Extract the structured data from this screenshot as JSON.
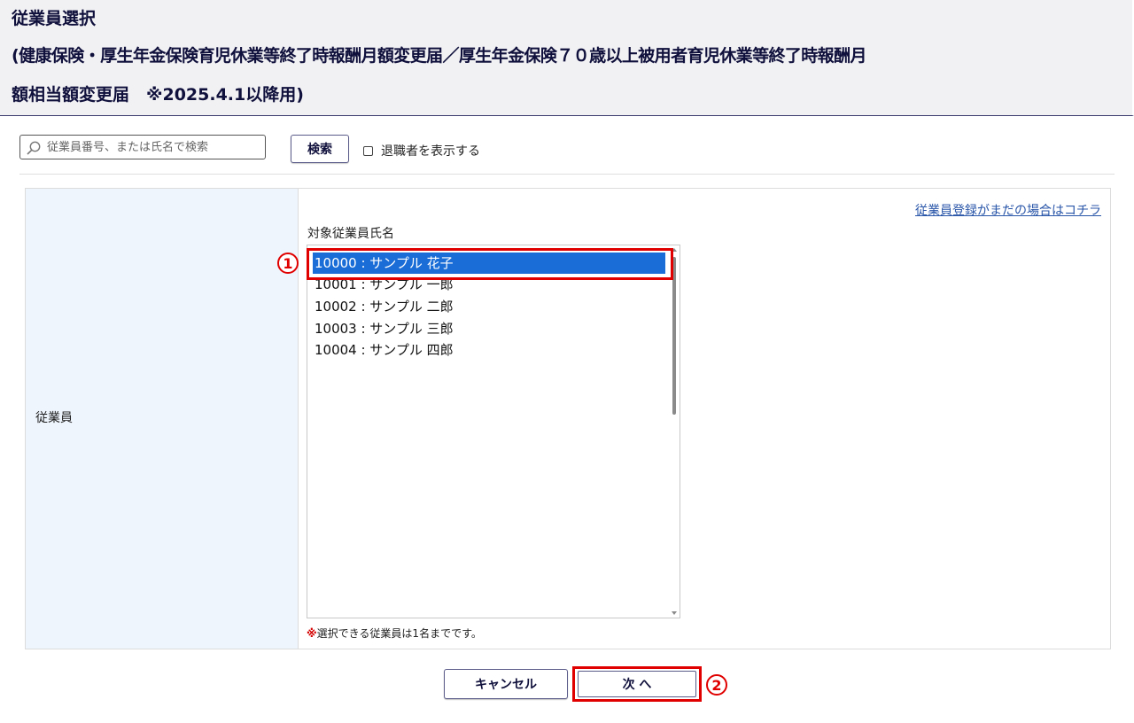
{
  "header": {
    "title": "従業員選択",
    "subtitle_line1": "(健康保険・厚生年金保険育児休業等終了時報酬月額変更届／厚生年金保険７０歳以上被用者育児休業等終了時報酬月",
    "subtitle_line2": "額相当額変更届　※2025.4.1以降用)"
  },
  "search": {
    "placeholder": "従業員番号、または氏名で検索",
    "value": "",
    "button_label": "検索",
    "show_retired_label": "退職者を表示する",
    "show_retired_checked": false
  },
  "form": {
    "row_label": "従業員",
    "register_link": "従業員登録がまだの場合はコチラ",
    "list_label": "対象従業員氏名",
    "employees": [
      {
        "label": "10000 : サンプル 花子",
        "selected": true
      },
      {
        "label": "10001 : サンプル 一郎",
        "selected": false
      },
      {
        "label": "10002 : サンプル 二郎",
        "selected": false
      },
      {
        "label": "10003 : サンプル 三郎",
        "selected": false
      },
      {
        "label": "10004 : サンプル 四郎",
        "selected": false
      }
    ],
    "note_mark": "※",
    "note_text": "選択できる従業員は1名までです。"
  },
  "annotations": {
    "step1": "1",
    "step2": "2"
  },
  "buttons": {
    "cancel_label": "キャンセル",
    "next_label": "次 へ"
  },
  "colors": {
    "header_bg": "#f1f1f3",
    "label_cell_bg": "#eef5fc",
    "selection": "#1a6dd6",
    "annotation_red": "#e00000",
    "link": "#2855a8"
  }
}
